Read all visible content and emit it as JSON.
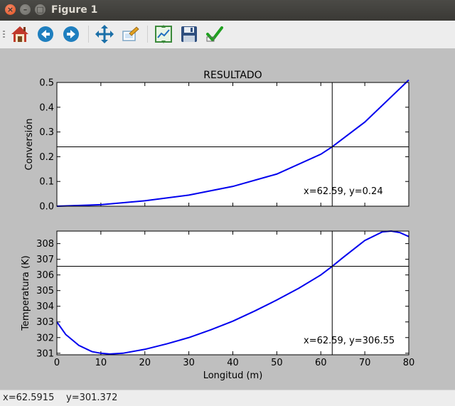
{
  "window": {
    "title": "Figure 1"
  },
  "toolbar": {
    "buttons": [
      {
        "icon": "home-icon",
        "tooltip": "Home"
      },
      {
        "icon": "back-icon",
        "tooltip": "Back"
      },
      {
        "icon": "forward-icon",
        "tooltip": "Forward"
      },
      {
        "icon": "pan-icon",
        "tooltip": "Pan"
      },
      {
        "icon": "zoom-icon",
        "tooltip": "Zoom"
      },
      {
        "icon": "subplots-icon",
        "tooltip": "Subplots"
      },
      {
        "icon": "save-icon",
        "tooltip": "Save"
      },
      {
        "icon": "edit-check-icon",
        "tooltip": "Edit"
      }
    ]
  },
  "status": {
    "x_text": "x=62.5915",
    "y_text": "y=301.372"
  },
  "colors": {
    "curve": "#0000ee",
    "cursor": "#000000",
    "figure_bg": "#bfbfbf"
  },
  "chart_data": [
    {
      "type": "line",
      "title": "RESULTADO",
      "xlabel": "",
      "ylabel": "Conversión",
      "xlim": [
        0,
        80
      ],
      "ylim": [
        0,
        0.5
      ],
      "yticks": [
        "0.0",
        "0.1",
        "0.2",
        "0.3",
        "0.4",
        "0.5"
      ],
      "x": [
        0,
        10,
        20,
        30,
        40,
        50,
        60,
        62.59,
        70,
        80
      ],
      "y": [
        0.0,
        0.006,
        0.022,
        0.045,
        0.08,
        0.13,
        0.21,
        0.24,
        0.34,
        0.51
      ],
      "cursor": {
        "x": 62.59,
        "y": 0.24
      },
      "annotation": "x=62.59, y=0.24"
    },
    {
      "type": "line",
      "xlabel": "Longitud (m)",
      "ylabel": "Temperatura (K)",
      "xlim": [
        0,
        80
      ],
      "ylim": [
        300.9,
        308.8
      ],
      "xticks": [
        "0",
        "10",
        "20",
        "30",
        "40",
        "50",
        "60",
        "70",
        "80"
      ],
      "yticks": [
        "301",
        "302",
        "303",
        "304",
        "305",
        "306",
        "307",
        "308"
      ],
      "x": [
        0,
        2,
        5,
        8,
        10,
        12,
        15,
        20,
        25,
        30,
        35,
        40,
        45,
        50,
        55,
        60,
        62.59,
        65,
        70,
        74,
        76,
        78,
        80
      ],
      "y": [
        303.0,
        302.2,
        301.5,
        301.1,
        301.0,
        300.95,
        301.0,
        301.25,
        301.6,
        302.0,
        302.5,
        303.05,
        303.7,
        304.4,
        305.15,
        306.0,
        306.55,
        307.1,
        308.2,
        308.75,
        308.8,
        308.7,
        308.45
      ],
      "cursor": {
        "x": 62.59,
        "y": 306.55
      },
      "annotation": "x=62.59, y=306.55"
    }
  ]
}
